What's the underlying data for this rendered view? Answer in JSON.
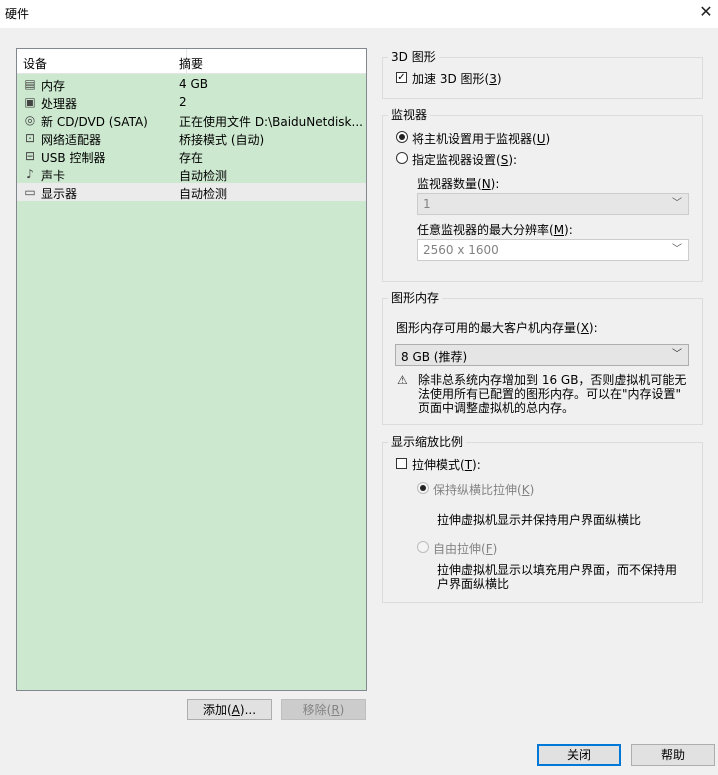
{
  "window": {
    "title": "硬件",
    "close_glyph": "✕"
  },
  "device_list": {
    "columns": [
      "设备",
      "摘要"
    ],
    "rows": [
      {
        "icon": "memory-icon",
        "glyph": "▤",
        "name": "内存",
        "summary": "4 GB"
      },
      {
        "icon": "cpu-icon",
        "glyph": "▣",
        "name": "处理器",
        "summary": "2"
      },
      {
        "icon": "cd-icon",
        "glyph": "◎",
        "name": "新 CD/DVD (SATA)",
        "summary": "正在使用文件 D:\\BaiduNetdisk..."
      },
      {
        "icon": "network-icon",
        "glyph": "⊡",
        "name": "网络适配器",
        "summary": "桥接模式 (自动)"
      },
      {
        "icon": "usb-icon",
        "glyph": "⊟",
        "name": "USB 控制器",
        "summary": "存在"
      },
      {
        "icon": "speaker-icon",
        "glyph": "♪",
        "name": "声卡",
        "summary": "自动检测"
      },
      {
        "icon": "monitor-icon",
        "glyph": "▭",
        "name": "显示器",
        "summary": "自动检测",
        "selected": true
      }
    ]
  },
  "buttons": {
    "add": {
      "text": "添加(",
      "key": "A",
      "tail": ")..."
    },
    "remove": {
      "text": "移除(",
      "key": "R",
      "tail": ")"
    },
    "close": "关闭",
    "help": "帮助"
  },
  "graphics3d": {
    "group_label": "3D 图形",
    "accelerate": {
      "text": "加速 3D 图形(",
      "key": "3",
      "tail": ")",
      "checked": true
    }
  },
  "monitors": {
    "group_label": "监视器",
    "use_host": {
      "text": "将主机设置用于监视器(",
      "key": "U",
      "tail": ")",
      "selected": true
    },
    "specify": {
      "text": "指定监视器设置(",
      "key": "S",
      "tail": "):",
      "selected": false
    },
    "count_label": {
      "text": "监视器数量(",
      "key": "N",
      "tail": "):"
    },
    "count_value": "1",
    "maxres_label": {
      "text": "任意监视器的最大分辨率(",
      "key": "M",
      "tail": "):"
    },
    "maxres_value": "2560 x 1600"
  },
  "graphics_memory": {
    "group_label": "图形内存",
    "max_label": {
      "text": "图形内存可用的最大客户机内存量(",
      "key": "X",
      "tail": "):"
    },
    "value": "8 GB (推荐)",
    "warning_line1": "除非总系统内存增加到 16 GB，否则虚拟机可能无",
    "warning_line2": "法使用所有已配置的图形内存。可以在\"内存设置\"",
    "warning_line3": "页面中调整虚拟机的总内存。"
  },
  "display_scaling": {
    "group_label": "显示缩放比例",
    "stretch": {
      "text": "拉伸模式(",
      "key": "T",
      "tail": "):",
      "checked": false
    },
    "keep_aspect": {
      "text": "保持纵横比拉伸(",
      "key": "K",
      "tail": ")"
    },
    "keep_aspect_desc": "拉伸虚拟机显示并保持用户界面纵横比",
    "free": {
      "text": "自由拉伸(",
      "key": "F",
      "tail": ")"
    },
    "free_desc_line1": "拉伸虚拟机显示以填充用户界面，而不保持用",
    "free_desc_line2": "户界面纵横比"
  }
}
